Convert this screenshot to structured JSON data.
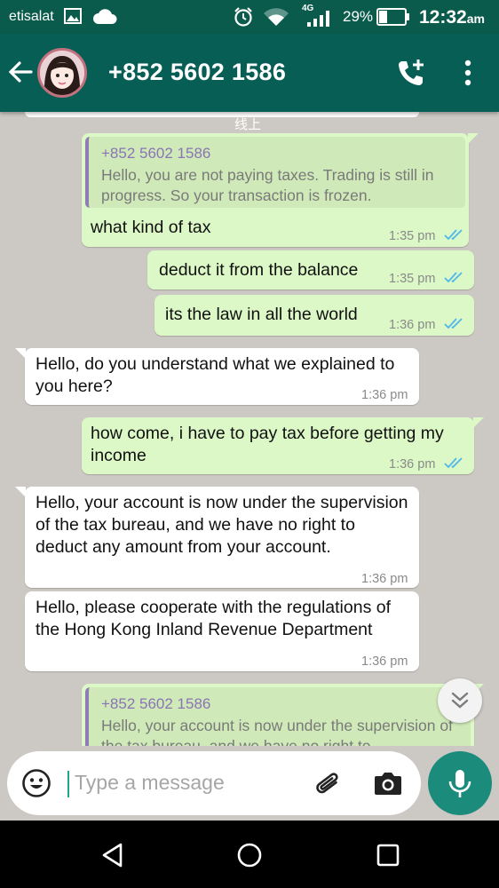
{
  "status_bar": {
    "carrier": "etisalat",
    "network": "4G",
    "battery": "29%",
    "time": "12:32",
    "ampm": "am"
  },
  "header": {
    "contact": "+852 5602 1586",
    "icons": [
      "back-arrow-icon",
      "add-call-icon",
      "more-vert-icon"
    ]
  },
  "chat": {
    "online_label": "线上",
    "messages": [
      {
        "dir": "out",
        "quote_name": "+852 5602 1586",
        "quote_text": "Hello, you are not paying taxes. Trading is still in progress. So your transaction is frozen.",
        "text": "what kind of tax",
        "time": "1:35 pm"
      },
      {
        "dir": "out",
        "text": "deduct it from the balance",
        "time": "1:35 pm"
      },
      {
        "dir": "out",
        "text": "its the law in all the world",
        "time": "1:36 pm"
      },
      {
        "dir": "in",
        "text": "Hello, do you understand what we explained to you here?",
        "time": "1:36 pm"
      },
      {
        "dir": "out",
        "text": "how come, i have to pay tax before getting my income",
        "time": "1:36 pm"
      },
      {
        "dir": "in",
        "text": "Hello, your account is now under the supervision of the tax bureau, and we have no right to deduct any amount from your account.",
        "time": "1:36 pm"
      },
      {
        "dir": "in",
        "text": "Hello, please cooperate with the regulations of the Hong Kong Inland Revenue Department",
        "time": "1:36 pm"
      },
      {
        "dir": "out",
        "quote_name": "+852 5602 1586",
        "quote_text": "Hello, your account is now under the supervision of the tax bureau, and we have no right to"
      }
    ]
  },
  "input": {
    "placeholder": "Type a message"
  },
  "colors": {
    "status_bar": "#0a5b4c",
    "app_bar": "#075e54",
    "outgoing_bubble": "#dcf8c6",
    "incoming_bubble": "#ffffff",
    "read_ticks": "#4fb6ec",
    "mic_button": "#1b8c7c"
  }
}
